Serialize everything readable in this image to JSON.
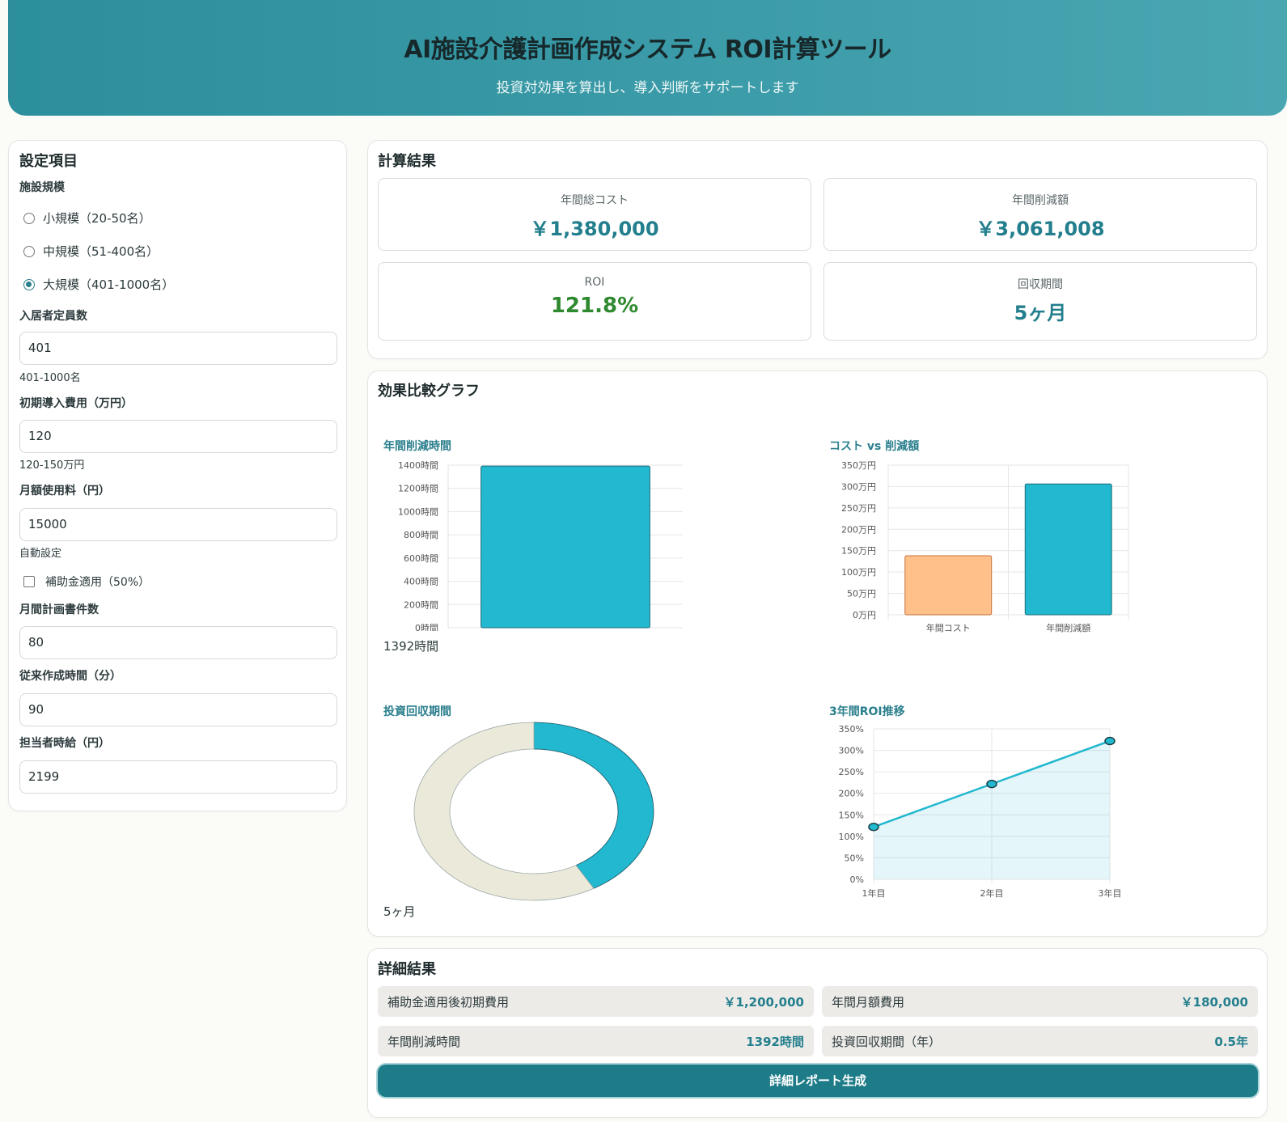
{
  "header": {
    "title": "AI施設介護計画作成システム ROI計算ツール",
    "subtitle": "投資対効果を算出し、導入判断をサポートします"
  },
  "settings": {
    "title": "設定項目",
    "facility_label": "施設規模",
    "radios": [
      {
        "label": "小規模（20-50名）",
        "selected": false
      },
      {
        "label": "中規模（51-400名）",
        "selected": false
      },
      {
        "label": "大規模（401-1000名）",
        "selected": true
      }
    ],
    "capacity_label": "入居者定員数",
    "capacity_value": "401",
    "capacity_hint": "401-1000名",
    "initial_cost_label": "初期導入費用（万円）",
    "initial_cost_value": "120",
    "initial_cost_hint": "120-150万円",
    "monthly_fee_label": "月額使用料（円）",
    "monthly_fee_value": "15000",
    "monthly_fee_hint": "自動設定",
    "subsidy_label": "補助金適用（50%）",
    "subsidy_checked": false,
    "plans_label": "月間計画書件数",
    "plans_value": "80",
    "time_label": "従来作成時間（分）",
    "time_value": "90",
    "wage_label": "担当者時給（円）",
    "wage_value": "2199"
  },
  "results": {
    "title": "計算結果",
    "cards": [
      {
        "label": "年間総コスト",
        "value": "￥1,380,000"
      },
      {
        "label": "年間削減額",
        "value": "￥3,061,008"
      },
      {
        "label": "ROI",
        "value": "121.8%"
      },
      {
        "label": "回収期間",
        "value": "5ヶ月"
      }
    ]
  },
  "charts": {
    "title": "効果比較グラフ",
    "hours_caption": "1392時間",
    "payback_caption": "5ヶ月"
  },
  "chart_data": [
    {
      "type": "bar",
      "title": "年間削減時間",
      "categories": [
        ""
      ],
      "values": [
        1392
      ],
      "ylim": [
        0,
        1400
      ],
      "yticks": [
        "0時間",
        "200時間",
        "400時間",
        "600時間",
        "800時間",
        "1000時間",
        "1200時間",
        "1400時間"
      ],
      "colors": [
        "#22b8cf"
      ]
    },
    {
      "type": "bar",
      "title": "コスト vs 削減額",
      "categories": [
        "年間コスト",
        "年間削減額"
      ],
      "values": [
        138,
        306.1
      ],
      "ylim": [
        0,
        350
      ],
      "yticks": [
        "0万円",
        "50万円",
        "100万円",
        "150万円",
        "200万円",
        "250万円",
        "300万円",
        "350万円"
      ],
      "colors": [
        "#ffc08a",
        "#22b8cf"
      ]
    },
    {
      "type": "pie",
      "title": "投資回収期間",
      "slices": [
        {
          "value": 5,
          "color": "#22b8cf"
        },
        {
          "value": 7,
          "color": "#ebe9d9"
        }
      ]
    },
    {
      "type": "line",
      "title": "3年間ROI推移",
      "x": [
        "1年目",
        "2年目",
        "3年目"
      ],
      "values": [
        121.8,
        221.8,
        321.8
      ],
      "ylim": [
        0,
        350
      ],
      "yticks": [
        "0%",
        "50%",
        "100%",
        "150%",
        "200%",
        "250%",
        "300%",
        "350%"
      ],
      "color": "#22b8cf"
    }
  ],
  "details": {
    "title": "詳細結果",
    "rows": [
      {
        "label": "補助金適用後初期費用",
        "value": "￥1,200,000"
      },
      {
        "label": "年間月額費用",
        "value": "￥180,000"
      },
      {
        "label": "年間削減時間",
        "value": "1392時間"
      },
      {
        "label": "投資回収期間（年）",
        "value": "0.5年"
      }
    ],
    "button_label": "詳細レポート生成"
  }
}
